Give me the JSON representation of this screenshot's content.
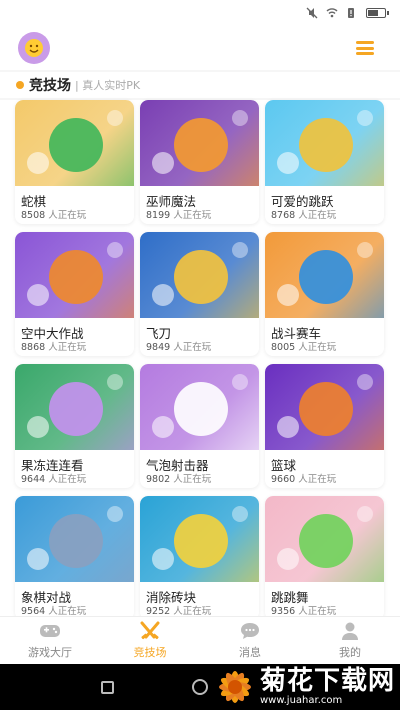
{
  "section": {
    "title": "竞技场",
    "subtitle": "| 真人实时PK"
  },
  "suffix": "人正在玩",
  "games": [
    {
      "name": "蛇棋",
      "players": "8508",
      "bg": "#f3c96a",
      "accent": "#3fb65a"
    },
    {
      "name": "巫师魔法",
      "players": "8199",
      "bg": "#7a3fb3",
      "accent": "#f59a2e"
    },
    {
      "name": "可爱的跳跃",
      "players": "8768",
      "bg": "#5cc8f0",
      "accent": "#f2c23a"
    },
    {
      "name": "空中大作战",
      "players": "8868",
      "bg": "#8a55d6",
      "accent": "#f08a2a"
    },
    {
      "name": "飞刀",
      "players": "9849",
      "bg": "#2f6ec8",
      "accent": "#f5c33b"
    },
    {
      "name": "战斗赛车",
      "players": "8005",
      "bg": "#f29a3a",
      "accent": "#2f8fe0"
    },
    {
      "name": "果冻连连看",
      "players": "9644",
      "bg": "#3aa86b",
      "accent": "#c590ef"
    },
    {
      "name": "气泡射击器",
      "players": "9802",
      "bg": "#b47be0",
      "accent": "#ffffff"
    },
    {
      "name": "篮球",
      "players": "9660",
      "bg": "#6a2fc0",
      "accent": "#f0812a"
    },
    {
      "name": "象棋对战",
      "players": "9564",
      "bg": "#3b9bd8",
      "accent": "#8aa0c0"
    },
    {
      "name": "消除砖块",
      "players": "9252",
      "bg": "#2aa3d6",
      "accent": "#f5d23a"
    },
    {
      "name": "跳跳舞",
      "players": "9356",
      "bg": "#f3b8c8",
      "accent": "#6fd35a"
    }
  ],
  "tabs": [
    {
      "label": "游戏大厅",
      "icon": "gamepad-icon",
      "active": false
    },
    {
      "label": "竞技场",
      "icon": "crossed-swords-icon",
      "active": true
    },
    {
      "label": "消息",
      "icon": "chat-bubble-icon",
      "active": false
    },
    {
      "label": "我的",
      "icon": "user-icon",
      "active": false
    }
  ],
  "watermark": {
    "title": "菊花下载网",
    "url": "www.juahar.com"
  },
  "colors": {
    "accent": "#f5a623",
    "tab_inactive": "#888888"
  }
}
